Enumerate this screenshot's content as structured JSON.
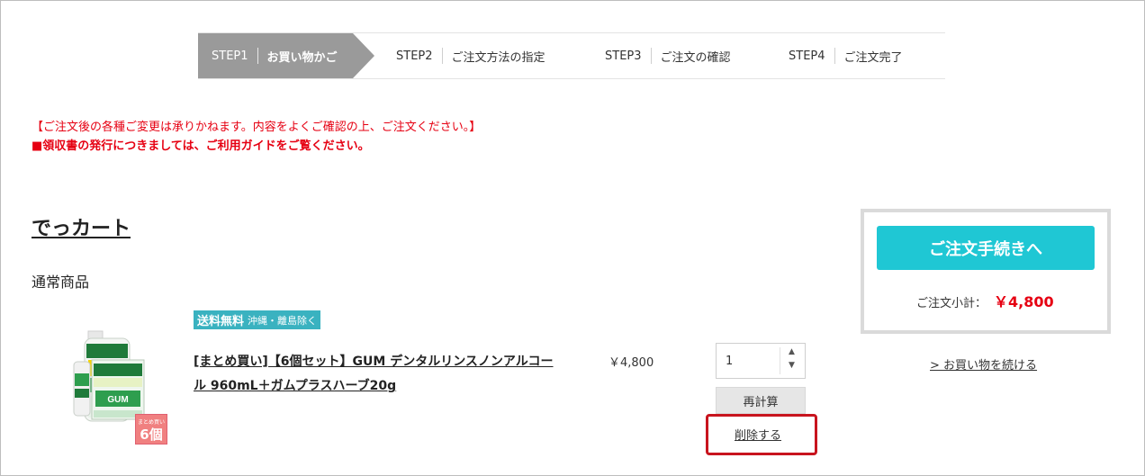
{
  "steps": [
    {
      "num": "STEP1",
      "label": "お買い物かご"
    },
    {
      "num": "STEP2",
      "label": "ご注文方法の指定"
    },
    {
      "num": "STEP3",
      "label": "ご注文の確認"
    },
    {
      "num": "STEP4",
      "label": "ご注文完了"
    }
  ],
  "notices": {
    "line1": "【ご注文後の各種ご変更は承りかねます。内容をよくご確認の上、ご注文ください。】",
    "line2": "■領収書の発行につきましては、ご利用ガイドをご覧ください。"
  },
  "cart": {
    "title": "でっカート",
    "section": "通常商品"
  },
  "product": {
    "badge_count": "6個",
    "badge_top": "まとめ買い",
    "shipping_main": "送料無料",
    "shipping_sub": "沖縄・離島除く",
    "name": "[まとめ買い]【6個セット】GUM デンタルリンスノンアルコール 960mL＋ガムプラスハーブ20g",
    "price": "￥4,800",
    "quantity": "1",
    "recalc_label": "再計算",
    "delete_label": "削除する"
  },
  "summary": {
    "order_button": "ご注文手続きへ",
    "subtotal_label": "ご注文小計：",
    "subtotal_value": "￥4,800",
    "continue_label": "> お買い物を続ける"
  },
  "colors": {
    "accent": "#1fc7d4",
    "notice": "#e60012",
    "shipping_badge": "#3ab2c0",
    "highlight": "#c8141e"
  }
}
